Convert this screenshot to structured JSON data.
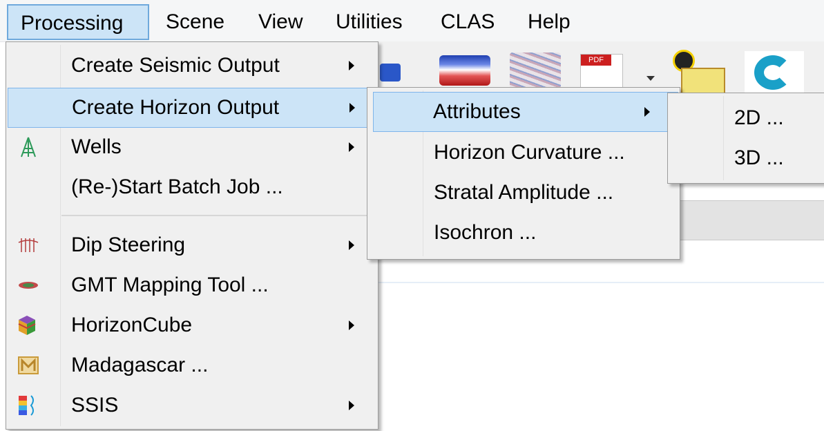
{
  "menubar": {
    "items": [
      {
        "label": "Processing",
        "active": true
      },
      {
        "label": "Scene"
      },
      {
        "label": "View"
      },
      {
        "label": "Utilities"
      },
      {
        "label": "CLAS"
      },
      {
        "label": "Help"
      }
    ]
  },
  "processing_menu": {
    "items": [
      {
        "label": "Create Seismic Output",
        "submenu": true
      },
      {
        "label": "Create Horizon Output",
        "submenu": true,
        "highlighted": true
      },
      {
        "label": "Wells",
        "submenu": true,
        "icon": "wells-derrick-icon"
      },
      {
        "label": "(Re-)Start Batch Job ..."
      },
      {
        "label": "Dip Steering",
        "submenu": true,
        "icon": "dip-steering-icon"
      },
      {
        "label": "GMT Mapping Tool ...",
        "icon": "gmt-map-icon"
      },
      {
        "label": "HorizonCube",
        "submenu": true,
        "icon": "horizoncube-icon"
      },
      {
        "label": "Madagascar ...",
        "icon": "madagascar-icon"
      },
      {
        "label": "SSIS",
        "submenu": true,
        "icon": "ssis-icon"
      }
    ]
  },
  "horizon_output_menu": {
    "items": [
      {
        "label": "Attributes",
        "submenu": true,
        "highlighted": true
      },
      {
        "label": "Horizon Curvature ..."
      },
      {
        "label": "Stratal Amplitude ..."
      },
      {
        "label": "Isochron ..."
      }
    ]
  },
  "attributes_menu": {
    "items": [
      {
        "label": "2D ..."
      },
      {
        "label": "3D ..."
      }
    ]
  },
  "toolbar": {
    "icons": [
      "seismic-display-icon",
      "horizon-display-icon",
      "pdf-export-icon",
      "dropdown-arrow-icon",
      "lamp-icon",
      "clas-logo-icon"
    ],
    "pdf_text": "PDF"
  },
  "colors": {
    "highlight": "#cce4f7",
    "highlight_border": "#7eb4ea",
    "menu_bg": "#f0f0f0"
  }
}
